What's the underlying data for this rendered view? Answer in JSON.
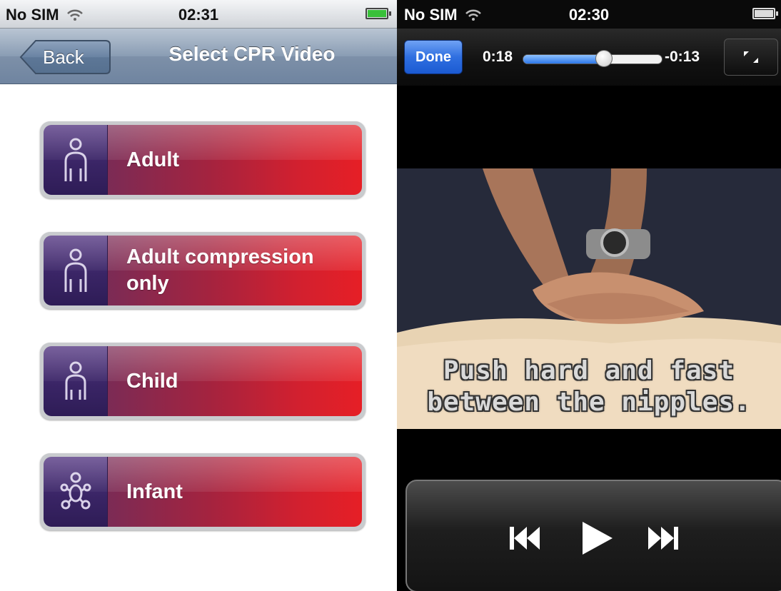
{
  "left_screen": {
    "status_bar": {
      "carrier": "No SIM",
      "time": "02:31"
    },
    "nav": {
      "back_label": "Back",
      "title": "Select CPR Video"
    },
    "options": [
      {
        "label": "Adult",
        "icon": "adult-icon"
      },
      {
        "label": "Adult compression only",
        "line1": "Adult compression",
        "line2": "only",
        "icon": "adult-icon"
      },
      {
        "label": "Child",
        "icon": "child-icon"
      },
      {
        "label": "Infant",
        "icon": "infant-icon"
      }
    ]
  },
  "right_screen": {
    "status_bar": {
      "carrier": "No SIM",
      "time": "02:30"
    },
    "player": {
      "done_label": "Done",
      "elapsed": "0:18",
      "remaining": "-0:13",
      "progress_fraction": 0.58,
      "subtitle_line1": "Push hard and fast",
      "subtitle_line2": "between the nipples.",
      "controls": [
        "previous-track-icon",
        "play-icon",
        "next-track-icon"
      ]
    }
  },
  "colors": {
    "button_red": "#e61f26",
    "icon_purple": "#3a2566",
    "nav_blue": "#7d90a8",
    "done_blue": "#2f6fe0"
  }
}
